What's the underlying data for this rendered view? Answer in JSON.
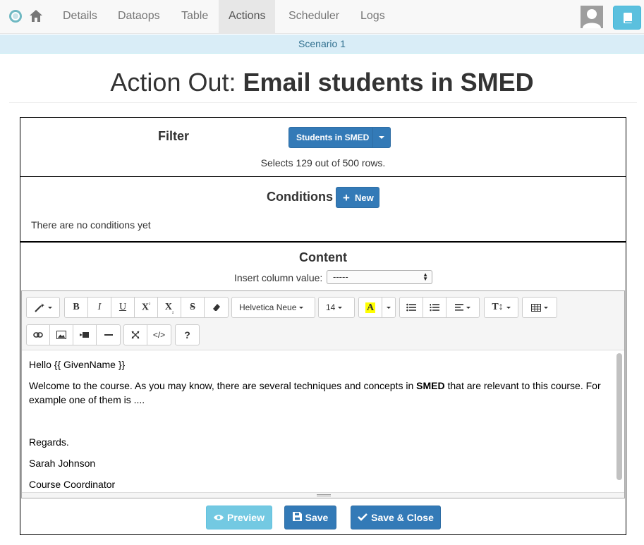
{
  "navbar": {
    "tabs": [
      "Details",
      "Dataops",
      "Table",
      "Actions",
      "Scheduler",
      "Logs"
    ],
    "active_tab": "Actions"
  },
  "scenario": "Scenario 1",
  "page": {
    "title_prefix": "Action Out:",
    "title_name": "Email students in SMED"
  },
  "filter": {
    "heading": "Filter",
    "button_label": "Students in SMED",
    "summary": "Selects 129 out of 500 rows."
  },
  "conditions": {
    "heading": "Conditions",
    "new_label": "New",
    "empty_text": "There are no conditions yet"
  },
  "content": {
    "heading": "Content",
    "insert_label": "Insert column value:",
    "insert_selected": "-----",
    "toolbar": {
      "font_name": "Helvetica Neue",
      "font_size": "14"
    },
    "body": {
      "greeting": "Hello {{ GivenName }}",
      "welcome_before": "Welcome to the course. As you may know, there are several techniques and concepts in ",
      "welcome_bold": "SMED",
      "welcome_after": " that are relevant to this course. For example one of them is ....",
      "regards": "Regards.",
      "sender_name": "Sarah Johnson",
      "sender_role": "Course Coordinator"
    }
  },
  "actions": {
    "preview": "Preview",
    "save": "Save",
    "save_close": "Save & Close"
  }
}
